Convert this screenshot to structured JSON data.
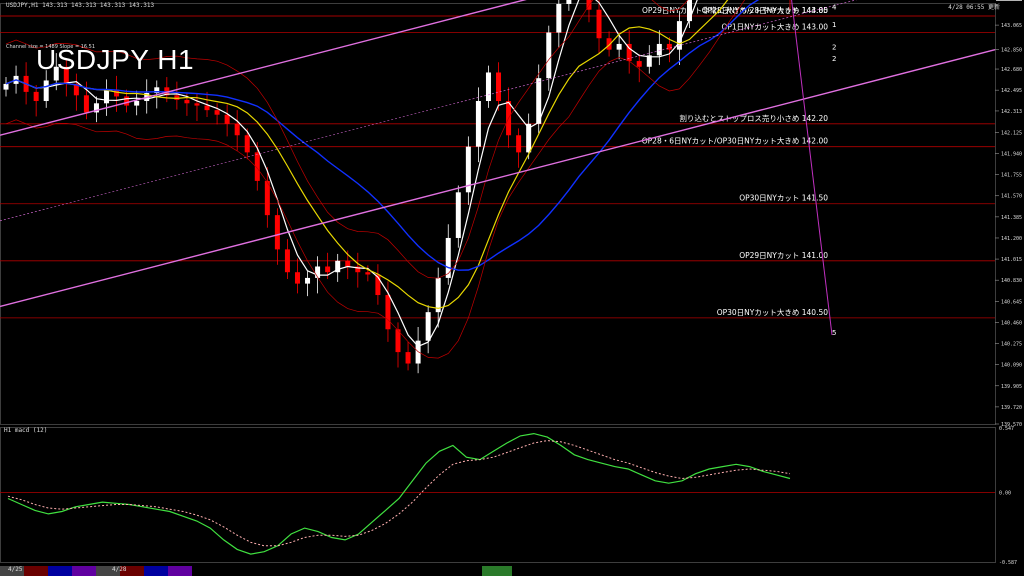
{
  "header": {
    "symbol_line": "USDJPY,H1  143.313 143.313 143.313 143.313",
    "timestamp": "4/28 06:55 更新"
  },
  "title": "USDJPY H1",
  "channel_info": "Channel size = 1489  Slope = 16.51",
  "macd_label": "H1  macd (12)",
  "dates": {
    "a": "4/25",
    "b": "4/28"
  },
  "colors": {
    "background": "#000000",
    "bull": "#ffffff",
    "bear": "#ff0000",
    "level_line": "#b00000",
    "channel": "#e070e0",
    "ma_white": "#ffffff",
    "ma_yellow": "#e8d800",
    "ma_blue": "#1030ff",
    "macd_main": "#40e040",
    "macd_signal": "#ffb0b0",
    "boll": "#c00000"
  },
  "chart_data": [
    {
      "type": "candlestick",
      "title": "USDJPY H1",
      "ylim": [
        139.57,
        143.25
      ],
      "y_ticks": [
        "143.065",
        "142.850",
        "142.680",
        "142.495",
        "142.313",
        "142.125",
        "141.940",
        "141.755",
        "141.570",
        "141.385",
        "141.200",
        "141.015",
        "140.830",
        "140.645",
        "140.460",
        "140.275",
        "140.090",
        "139.905",
        "139.720",
        "139.570"
      ],
      "price_levels": [
        {
          "label": "OP29日NYカット非常に大きめ/28日NYカット 144.00",
          "value": 144.0
        },
        {
          "label": "OP28日NYカットやや大きめ 143.85",
          "value": 143.85
        },
        {
          "label": "OP1日NYカット大きめ 143.00",
          "value": 143.0
        },
        {
          "label": "割り込むとストップロス売り小さめ 142.20",
          "value": 142.2
        },
        {
          "label": "OP28・6日NYカット/OP30日NYカット大きめ 142.00",
          "value": 142.0
        },
        {
          "label": "OP30日NYカット 141.50",
          "value": 141.5
        },
        {
          "label": "OP29日NYカット 141.00",
          "value": 141.0
        },
        {
          "label": "OP30日NYカット大きめ 140.50",
          "value": 140.5
        }
      ],
      "wave_labels": [
        "3",
        "4",
        "1",
        "2",
        "2",
        "5"
      ],
      "last_price": "143.313",
      "close_series": [
        142.55,
        142.62,
        142.48,
        142.4,
        142.58,
        142.7,
        142.55,
        142.45,
        142.3,
        142.38,
        142.5,
        142.44,
        142.36,
        142.4,
        142.47,
        142.52,
        142.45,
        142.41,
        142.38,
        142.36,
        142.32,
        142.28,
        142.2,
        142.1,
        141.95,
        141.7,
        141.4,
        141.1,
        140.9,
        140.8,
        140.85,
        140.95,
        140.9,
        141.0,
        140.95,
        140.9,
        140.88,
        140.7,
        140.4,
        140.2,
        140.1,
        140.3,
        140.55,
        140.85,
        141.2,
        141.6,
        142.0,
        142.4,
        142.65,
        142.4,
        142.1,
        141.95,
        142.2,
        142.6,
        143.0,
        143.25,
        143.4,
        143.5,
        143.2,
        142.95,
        142.85,
        142.9,
        142.75,
        142.7,
        142.8,
        142.9,
        142.85,
        143.1,
        143.6,
        143.8,
        143.7,
        143.75,
        143.9,
        143.85,
        143.95,
        143.8,
        143.7,
        143.55,
        143.31
      ],
      "macd": {
        "ylim": [
          -0.587,
          0.547
        ],
        "y_ticks": [
          "0.547",
          "0.00",
          "-0.587"
        ],
        "main": [
          -0.05,
          -0.1,
          -0.15,
          -0.18,
          -0.16,
          -0.12,
          -0.1,
          -0.08,
          -0.09,
          -0.1,
          -0.12,
          -0.14,
          -0.16,
          -0.2,
          -0.24,
          -0.3,
          -0.4,
          -0.48,
          -0.52,
          -0.5,
          -0.45,
          -0.35,
          -0.3,
          -0.33,
          -0.38,
          -0.4,
          -0.35,
          -0.25,
          -0.15,
          -0.05,
          0.1,
          0.25,
          0.35,
          0.4,
          0.3,
          0.28,
          0.35,
          0.42,
          0.48,
          0.5,
          0.47,
          0.4,
          0.32,
          0.28,
          0.25,
          0.22,
          0.2,
          0.15,
          0.1,
          0.08,
          0.1,
          0.16,
          0.2,
          0.22,
          0.24,
          0.22,
          0.18,
          0.15,
          0.12
        ],
        "signal": [
          -0.03,
          -0.06,
          -0.1,
          -0.13,
          -0.14,
          -0.13,
          -0.12,
          -0.11,
          -0.1,
          -0.1,
          -0.11,
          -0.12,
          -0.14,
          -0.16,
          -0.19,
          -0.23,
          -0.29,
          -0.36,
          -0.42,
          -0.45,
          -0.45,
          -0.42,
          -0.38,
          -0.36,
          -0.36,
          -0.37,
          -0.36,
          -0.32,
          -0.26,
          -0.18,
          -0.08,
          0.04,
          0.15,
          0.24,
          0.27,
          0.28,
          0.3,
          0.34,
          0.38,
          0.42,
          0.44,
          0.43,
          0.4,
          0.36,
          0.32,
          0.28,
          0.25,
          0.21,
          0.17,
          0.14,
          0.12,
          0.13,
          0.15,
          0.17,
          0.19,
          0.2,
          0.19,
          0.18,
          0.16
        ]
      }
    }
  ]
}
